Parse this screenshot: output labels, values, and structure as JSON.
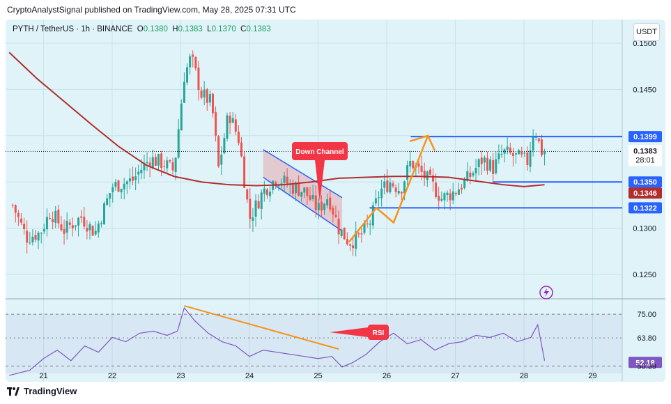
{
  "header": {
    "publisher_line": "CryptoAnalystSignal published on TradingView.com, May 28, 2025 07:31 UTC"
  },
  "symbol": {
    "name": "PYTH / TetherUS · 1h · BINANCE",
    "o_label": "O",
    "o_value": "0.1380",
    "h_label": "H",
    "h_value": "0.1383",
    "l_label": "L",
    "l_value": "0.1370",
    "c_label": "C",
    "c_value": "0.1383"
  },
  "currency_button": "USDT",
  "footer": {
    "brand": "TradingView",
    "icon": "tradingview-logo-icon"
  },
  "colors": {
    "up": "#26a69a",
    "down": "#ef5350",
    "ma": "#b22d2d",
    "level": "#2962ff",
    "arrow": "#f7931a",
    "rsi": "#7e57c2",
    "bg": "#dff3f8"
  },
  "chart_data": [
    {
      "type": "candlestick",
      "ylim": [
        0.124,
        0.1515
      ],
      "yticks": [
        "0.1500",
        "0.1450",
        "0.1350",
        "0.1300",
        "0.1250"
      ],
      "x_dates": [
        "21",
        "22",
        "23",
        "24",
        "25",
        "26",
        "27",
        "28",
        "29"
      ],
      "candles_x_range": [
        20.55,
        28.3
      ],
      "close_path": [
        [
          20.55,
          0.1325
        ],
        [
          20.75,
          0.129
        ],
        [
          20.95,
          0.1295
        ],
        [
          21.1,
          0.1318
        ],
        [
          21.3,
          0.1298
        ],
        [
          21.55,
          0.1312
        ],
        [
          21.75,
          0.1295
        ],
        [
          22.0,
          0.1345
        ],
        [
          22.3,
          0.1352
        ],
        [
          22.4,
          0.1362
        ],
        [
          22.55,
          0.1375
        ],
        [
          22.75,
          0.137
        ],
        [
          22.9,
          0.1362
        ],
        [
          23.05,
          0.1465
        ],
        [
          23.15,
          0.1485
        ],
        [
          23.3,
          0.1445
        ],
        [
          23.45,
          0.1435
        ],
        [
          23.55,
          0.1365
        ],
        [
          23.7,
          0.1425
        ],
        [
          23.85,
          0.1395
        ],
        [
          24.0,
          0.131
        ],
        [
          24.2,
          0.134
        ],
        [
          24.4,
          0.1355
        ],
        [
          24.6,
          0.1345
        ],
        [
          24.8,
          0.134
        ],
        [
          25.0,
          0.132
        ],
        [
          25.15,
          0.1335
        ],
        [
          25.3,
          0.13
        ],
        [
          25.45,
          0.1285
        ],
        [
          25.6,
          0.129
        ],
        [
          25.75,
          0.1305
        ],
        [
          25.9,
          0.134
        ],
        [
          26.05,
          0.135
        ],
        [
          26.2,
          0.1342
        ],
        [
          26.35,
          0.1372
        ],
        [
          26.5,
          0.136
        ],
        [
          26.65,
          0.1348
        ],
        [
          26.8,
          0.1332
        ],
        [
          27.0,
          0.134
        ],
        [
          27.2,
          0.1355
        ],
        [
          27.4,
          0.1375
        ],
        [
          27.55,
          0.1365
        ],
        [
          27.7,
          0.1382
        ],
        [
          27.85,
          0.1378
        ],
        [
          28.05,
          0.1372
        ],
        [
          28.15,
          0.141
        ],
        [
          28.25,
          0.1383
        ]
      ],
      "moving_average": [
        [
          20.5,
          0.149
        ],
        [
          20.9,
          0.1462
        ],
        [
          21.3,
          0.1437
        ],
        [
          21.7,
          0.1412
        ],
        [
          22.1,
          0.1388
        ],
        [
          22.5,
          0.1368
        ],
        [
          22.9,
          0.1356
        ],
        [
          23.3,
          0.135
        ],
        [
          23.7,
          0.1347
        ],
        [
          24.1,
          0.1346
        ],
        [
          24.5,
          0.1347
        ],
        [
          24.9,
          0.135
        ],
        [
          25.3,
          0.1354
        ],
        [
          25.7,
          0.1355
        ],
        [
          26.1,
          0.1356
        ],
        [
          26.5,
          0.1356
        ],
        [
          26.9,
          0.1355
        ],
        [
          27.3,
          0.1351
        ],
        [
          27.7,
          0.1347
        ],
        [
          28.0,
          0.1345
        ],
        [
          28.3,
          0.1347
        ]
      ],
      "down_channel": {
        "upper": [
          [
            24.2,
            0.1385
          ],
          [
            25.35,
            0.1333
          ]
        ],
        "lower": [
          [
            24.2,
            0.1355
          ],
          [
            25.35,
            0.1297
          ]
        ],
        "label": "Down Channel"
      },
      "levels": [
        {
          "price": 0.1399,
          "label": "0.1399",
          "x_from": 26.35
        },
        {
          "price": 0.135,
          "label": "0.1350",
          "x_from": 27.55
        },
        {
          "price": 0.1322,
          "label": "0.1322",
          "x_from": 25.75
        }
      ],
      "projection_arrow": [
        [
          25.45,
          0.1285
        ],
        [
          25.85,
          0.1322
        ],
        [
          26.1,
          0.1306
        ],
        [
          26.6,
          0.14
        ],
        [
          26.7,
          0.1384
        ]
      ],
      "last_price": {
        "value": "0.1383",
        "countdown": "28:01"
      },
      "ma_value_label": "0.1346",
      "lightning_icon": "lightning-icon"
    },
    {
      "type": "line",
      "name": "RSI",
      "ylim": [
        45,
        80
      ],
      "levels": [
        75.0,
        63.8,
        52.18,
        50.39
      ],
      "level_labels": [
        "75.00",
        "63.80",
        "52.18",
        "50.39"
      ],
      "values": [
        [
          20.5,
          46
        ],
        [
          20.8,
          48.5
        ],
        [
          21.0,
          54
        ],
        [
          21.2,
          58
        ],
        [
          21.4,
          53
        ],
        [
          21.6,
          60
        ],
        [
          21.8,
          57
        ],
        [
          22.0,
          64
        ],
        [
          22.2,
          62
        ],
        [
          22.4,
          66
        ],
        [
          22.6,
          67
        ],
        [
          22.8,
          65
        ],
        [
          22.95,
          67
        ],
        [
          23.05,
          78
        ],
        [
          23.2,
          72
        ],
        [
          23.4,
          66
        ],
        [
          23.6,
          62
        ],
        [
          23.8,
          60
        ],
        [
          24.0,
          55
        ],
        [
          24.2,
          58
        ],
        [
          24.4,
          57
        ],
        [
          24.6,
          56
        ],
        [
          24.8,
          55
        ],
        [
          25.0,
          54
        ],
        [
          25.2,
          55
        ],
        [
          25.35,
          50
        ],
        [
          25.5,
          52
        ],
        [
          25.7,
          56
        ],
        [
          25.9,
          62
        ],
        [
          26.1,
          66
        ],
        [
          26.3,
          61
        ],
        [
          26.5,
          63
        ],
        [
          26.7,
          58
        ],
        [
          26.9,
          61
        ],
        [
          27.1,
          62
        ],
        [
          27.3,
          65
        ],
        [
          27.5,
          64
        ],
        [
          27.7,
          66
        ],
        [
          27.9,
          62
        ],
        [
          28.1,
          64
        ],
        [
          28.2,
          70
        ],
        [
          28.3,
          53
        ]
      ],
      "trendline": [
        [
          23.05,
          79
        ],
        [
          25.3,
          58.5
        ]
      ],
      "rsi_badge": "RSI"
    }
  ]
}
